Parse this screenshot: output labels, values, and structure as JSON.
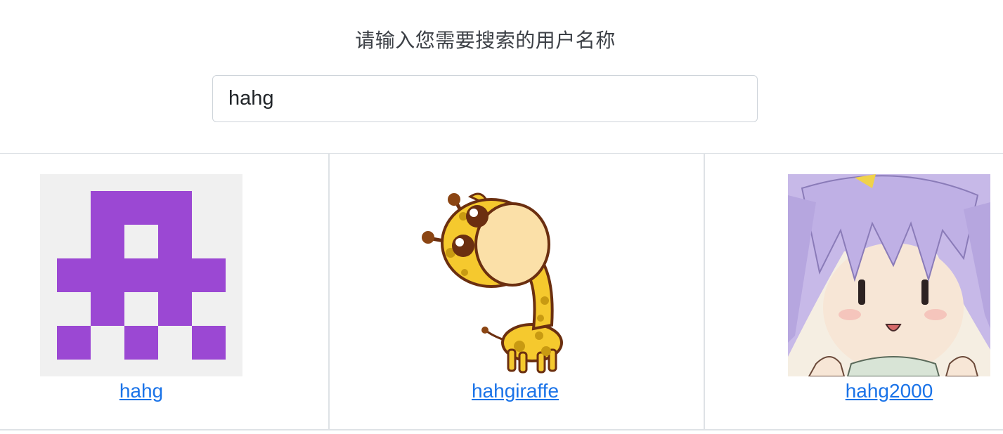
{
  "search": {
    "prompt": "请输入您需要搜索的用户名称",
    "value": "hahg"
  },
  "results": [
    {
      "username": "hahg",
      "avatar": "identicon-avatar"
    },
    {
      "username": "hahgiraffe",
      "avatar": "giraffe-avatar"
    },
    {
      "username": "hahg2000",
      "avatar": "anime-girl-avatar"
    }
  ],
  "colors": {
    "link": "#1a73e8",
    "identicon": "#9b48d3",
    "identicon_bg": "#f0f0f0",
    "border": "#dee2e6"
  }
}
